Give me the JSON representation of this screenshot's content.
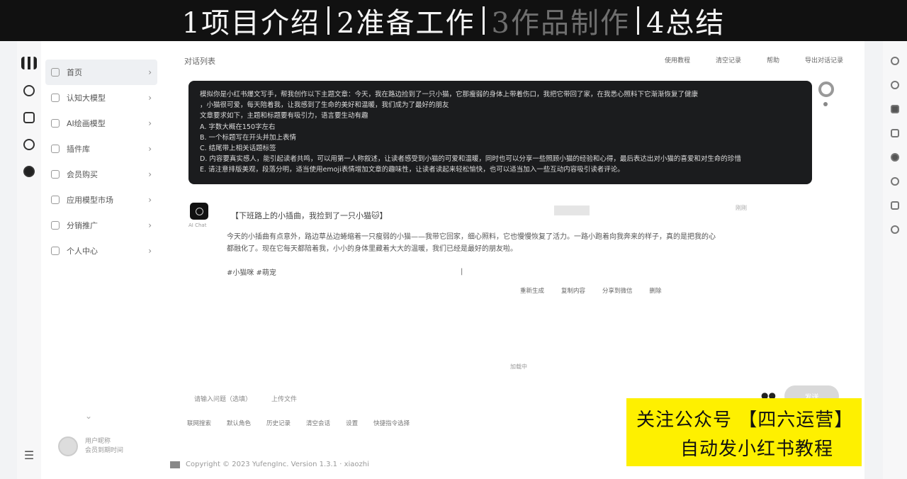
{
  "banner": {
    "steps": [
      {
        "label": "1项目介绍",
        "active": true
      },
      {
        "label": "2准备工作",
        "active": true
      },
      {
        "label": "3作品制作",
        "active": false
      },
      {
        "label": "4总结",
        "active": true
      }
    ]
  },
  "nav": {
    "items": [
      {
        "label": "首页",
        "icon": "home-icon"
      },
      {
        "label": "认知大模型",
        "icon": "brain-icon"
      },
      {
        "label": "AI绘画模型",
        "icon": "image-icon"
      },
      {
        "label": "插件库",
        "icon": "plugin-icon"
      },
      {
        "label": "会员购买",
        "icon": "user-icon"
      },
      {
        "label": "应用模型市场",
        "icon": "market-icon"
      },
      {
        "label": "分销推广",
        "icon": "share-icon"
      },
      {
        "label": "个人中心",
        "icon": "profile-icon"
      }
    ]
  },
  "main": {
    "header": "对话列表",
    "links": [
      "使用教程",
      "清空记录",
      "帮助",
      "导出对话记录"
    ],
    "prompt_lines": [
      "模拟你是小红书爆文写手，帮我创作以下主题文章：今天，我在路边捡到了一只小猫，它那瘦弱的身体上带着伤口，我把它带回了家，在我悉心照料下它渐渐恢复了健康",
      "，小猫很可爱，每天陪着我，让我感到了生命的美好和温暖，我们成为了最好的朋友",
      "文章要求如下，主题和标题要有吸引力，语言要生动有趣",
      "A. 字数大概在150字左右",
      "B. 一个标题写在开头并加上表情",
      "C. 结尾带上相关话题标签",
      "D. 内容要真实感人，能引起读者共鸣，可以用第一人称叙述，让读者感受到小猫的可爱和温暖，同时也可以分享一些照顾小猫的经验和心得，最后表达出对小猫的喜爱和对生命的珍惜",
      "E. 请注意排版美观，段落分明，适当使用emoji表情增加文章的趣味性，让读者读起来轻松愉快，也可以适当加入一些互动内容吸引读者评论。"
    ],
    "reply": {
      "bot_name": "AI Chat",
      "title": "【下班路上的小插曲，我捡到了一只小猫🐱】",
      "ago": "刚刚",
      "body": "今天的小插曲有点意外，路边草丛边蜷缩着一只瘦弱的小猫——我带它回家，细心照料，它也慢慢恢复了活力。一路小跑着向我奔来的样子，真的是把我的心都融化了。现在它每天都陪着我，小小的身体里藏着大大的温暖，我们已经是最好的朋友啦。",
      "tags": "#小猫咪 #萌宠",
      "actions": [
        "重新生成",
        "复制内容",
        "分享到微信",
        "删除"
      ]
    },
    "loading": "加载中",
    "input_bar": [
      "请输入问题（选填）",
      "上传文件"
    ],
    "tools": [
      "联网搜索",
      "默认角色",
      "历史记录",
      "清空会话",
      "设置",
      "快捷指令选择"
    ],
    "send": "发送"
  },
  "footer": {
    "text": "Copyright © 2023 YufengInc. Version 1.3.1 · xiaozhi"
  },
  "user": {
    "name": "用户昵称",
    "sub": "会员到期时间"
  },
  "promo": {
    "line1": "关注公众号 【四六运营】",
    "line2": "自动发小红书教程"
  }
}
